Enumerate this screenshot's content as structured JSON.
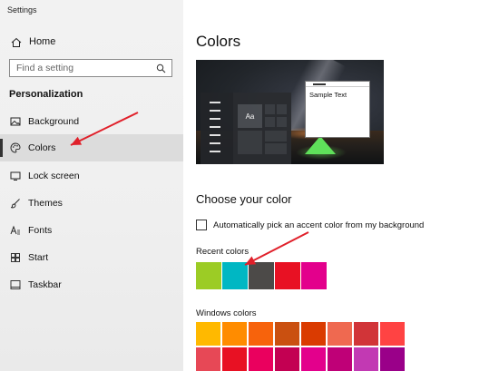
{
  "window": {
    "title": "Settings"
  },
  "sidebar": {
    "home_label": "Home",
    "search_placeholder": "Find a setting",
    "section": "Personalization",
    "items": [
      {
        "label": "Background",
        "icon": "picture-icon"
      },
      {
        "label": "Colors",
        "icon": "palette-icon",
        "active": true
      },
      {
        "label": "Lock screen",
        "icon": "lock-screen-icon"
      },
      {
        "label": "Themes",
        "icon": "brush-icon"
      },
      {
        "label": "Fonts",
        "icon": "font-icon"
      },
      {
        "label": "Start",
        "icon": "start-icon"
      },
      {
        "label": "Taskbar",
        "icon": "taskbar-icon"
      }
    ]
  },
  "main": {
    "title": "Colors",
    "preview": {
      "sample_text": "Sample Text",
      "tile_label": "Aa"
    },
    "choose_heading": "Choose your color",
    "auto_accent": {
      "label": "Automatically pick an accent color from my background",
      "checked": false
    },
    "recent_colors_label": "Recent colors",
    "recent_colors": [
      "#9ccc25",
      "#00b7c3",
      "#4c4a48",
      "#e81123",
      "#e3008c"
    ],
    "windows_colors_label": "Windows colors",
    "windows_colors": [
      [
        "#ffb900",
        "#ff8c00",
        "#f7630c",
        "#ca5010",
        "#da3b01",
        "#ef6950",
        "#d13438",
        "#ff4343"
      ],
      [
        "#e74856",
        "#e81123",
        "#ea005e",
        "#c30052",
        "#e3008c",
        "#bf0077",
        "#c239b3",
        "#9a0089"
      ]
    ]
  },
  "annotations": {
    "arrow_color": "#e0202a"
  }
}
